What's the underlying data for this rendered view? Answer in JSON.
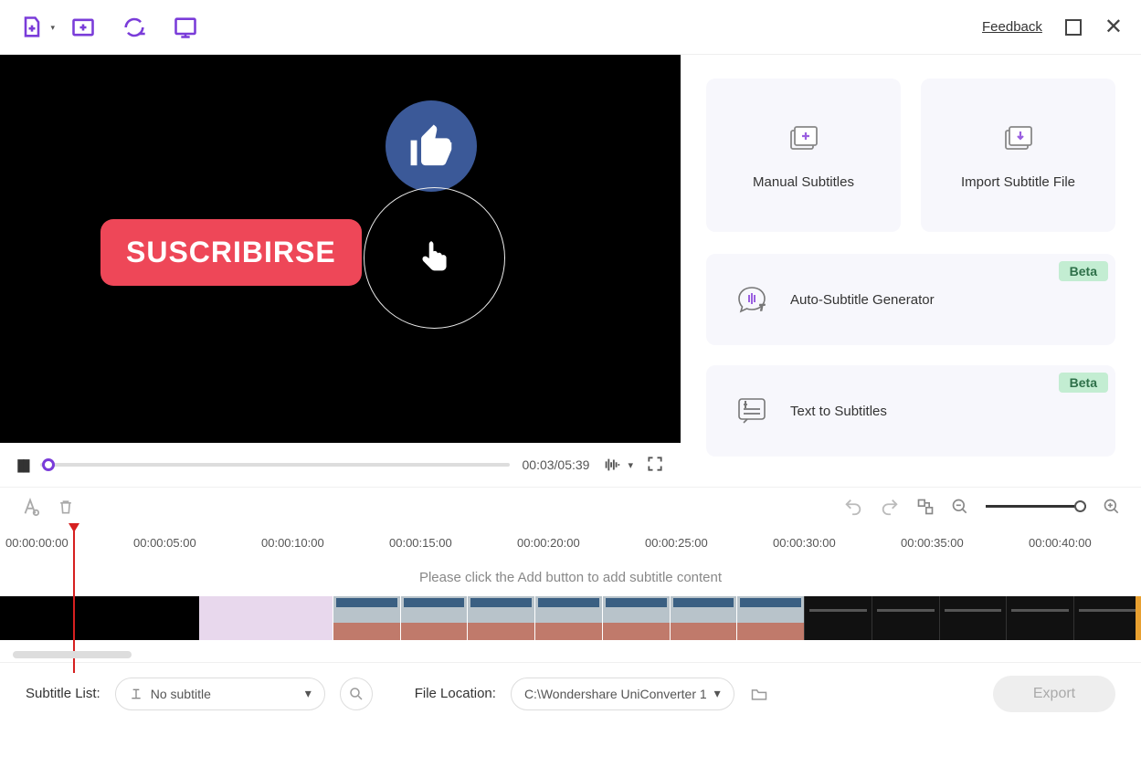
{
  "titlebar": {
    "feedback": "Feedback"
  },
  "video": {
    "subscribe_text": "SUSCRIBIRSE"
  },
  "playback": {
    "time": "00:03/05:39"
  },
  "tiles": {
    "manual": "Manual Subtitles",
    "import": "Import Subtitle File",
    "auto": "Auto-Subtitle Generator",
    "tts": "Text to Subtitles",
    "beta": "Beta"
  },
  "timeline": {
    "ticks": [
      "00:00:00:00",
      "00:00:05:00",
      "00:00:10:00",
      "00:00:15:00",
      "00:00:20:00",
      "00:00:25:00",
      "00:00:30:00",
      "00:00:35:00",
      "00:00:40:00"
    ],
    "hint": "Please click the Add button to add subtitle content"
  },
  "bottom": {
    "subtitle_list_label": "Subtitle List:",
    "no_subtitle": "No subtitle",
    "file_location_label": "File Location:",
    "path": "C:\\Wondershare UniConverter 1",
    "export": "Export"
  }
}
